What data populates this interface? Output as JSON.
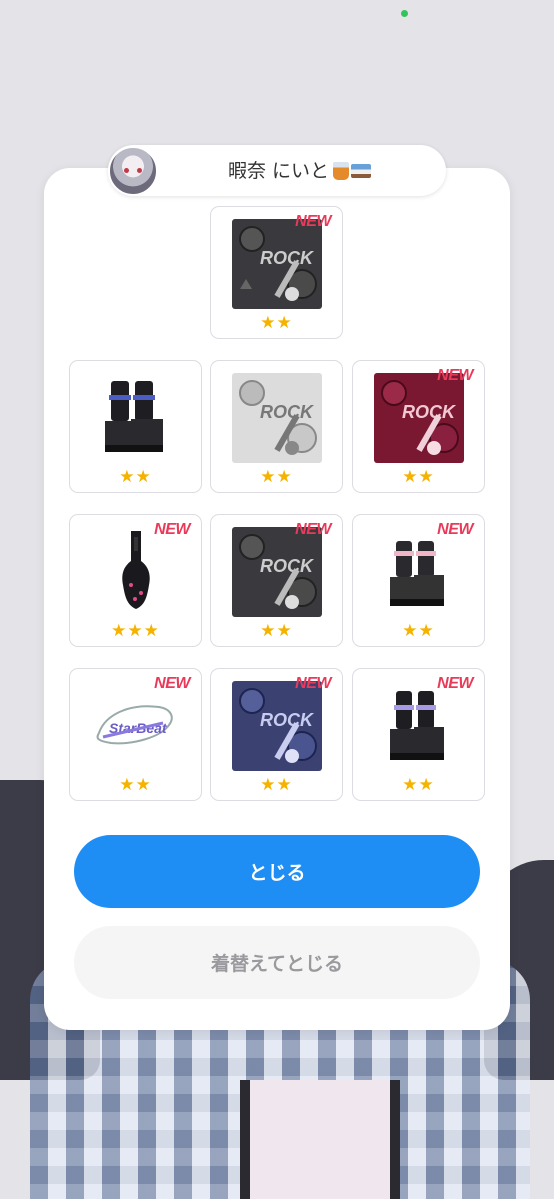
{
  "header": {
    "user_name": "暇奈 にいと",
    "emoji": [
      "glass-emoji",
      "bed-emoji"
    ]
  },
  "items": [
    {
      "art": "rock-print-dark",
      "new": true,
      "stars": "★★"
    },
    {
      "art": "boots-black-blue-strap",
      "new": false,
      "stars": "★★"
    },
    {
      "art": "rock-print-white",
      "new": false,
      "stars": "★★"
    },
    {
      "art": "rock-print-red",
      "new": true,
      "stars": "★★"
    },
    {
      "art": "guitar-case",
      "new": true,
      "stars": "★★★"
    },
    {
      "art": "rock-print-dark",
      "new": true,
      "stars": "★★"
    },
    {
      "art": "boots-black-pink-strap",
      "new": true,
      "stars": "★★"
    },
    {
      "art": "sticker-logo",
      "new": true,
      "stars": "★★"
    },
    {
      "art": "rock-print-blue",
      "new": true,
      "stars": "★★"
    },
    {
      "art": "boots-black-purple-strap",
      "new": true,
      "stars": "★★"
    }
  ],
  "new_label": "NEW",
  "buttons": {
    "close": "とじる",
    "change_and_close": "着替えてとじる"
  },
  "colors": {
    "primary": "#1e8ef5",
    "new_tag": "#ea3a5a",
    "star": "#f5b300"
  }
}
